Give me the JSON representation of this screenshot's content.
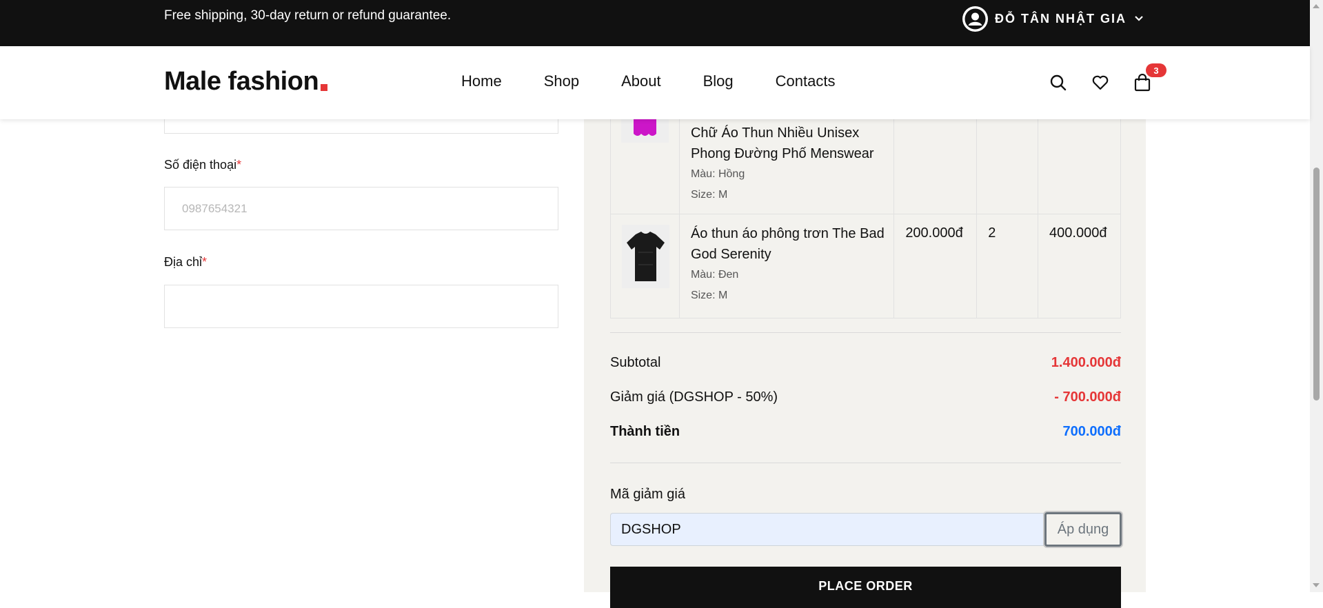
{
  "topbar": {
    "notice": "Free shipping, 30-day return or refund guarantee.",
    "account_name": "ĐỖ TÂN NHẬT GIA"
  },
  "header": {
    "logo_text": "Male fashion",
    "nav": [
      "Home",
      "Shop",
      "About",
      "Blog",
      "Contacts"
    ],
    "cart_count": "3"
  },
  "form": {
    "phone_label": "Số điện thoại",
    "phone_placeholder": "0987654321",
    "address_label": "Địa chỉ",
    "required_mark": "*"
  },
  "order": {
    "items": [
      {
        "name": "Chữ Áo Thun Nhiều Unisex Phong Đường Phố Menswear",
        "color": "Màu: Hồng",
        "size": "Size: M",
        "price": "",
        "qty": "",
        "total": "",
        "image_color": "#cc16c8"
      },
      {
        "name": "Áo thun áo phông trơn The Bad God Serenity",
        "color": "Màu: Đen",
        "size": "Size: M",
        "price": "200.000đ",
        "qty": "2",
        "total": "400.000đ",
        "image_color": "#1a1a1a"
      }
    ],
    "subtotal_label": "Subtotal",
    "subtotal_value": "1.400.000đ",
    "discount_label": "Giảm giá (DGSHOP - 50%)",
    "discount_value": "- 700.000đ",
    "total_label": "Thành tiền",
    "total_value": "700.000đ",
    "coupon_label": "Mã giảm giá",
    "coupon_value": "DGSHOP",
    "apply_label": "Áp dụng",
    "place_order_label": "PLACE ORDER"
  },
  "colors": {
    "accent_red": "#e53637",
    "total_blue": "#0d6efd",
    "panel_bg": "#f3f2ee",
    "topbar_bg": "#111111"
  }
}
